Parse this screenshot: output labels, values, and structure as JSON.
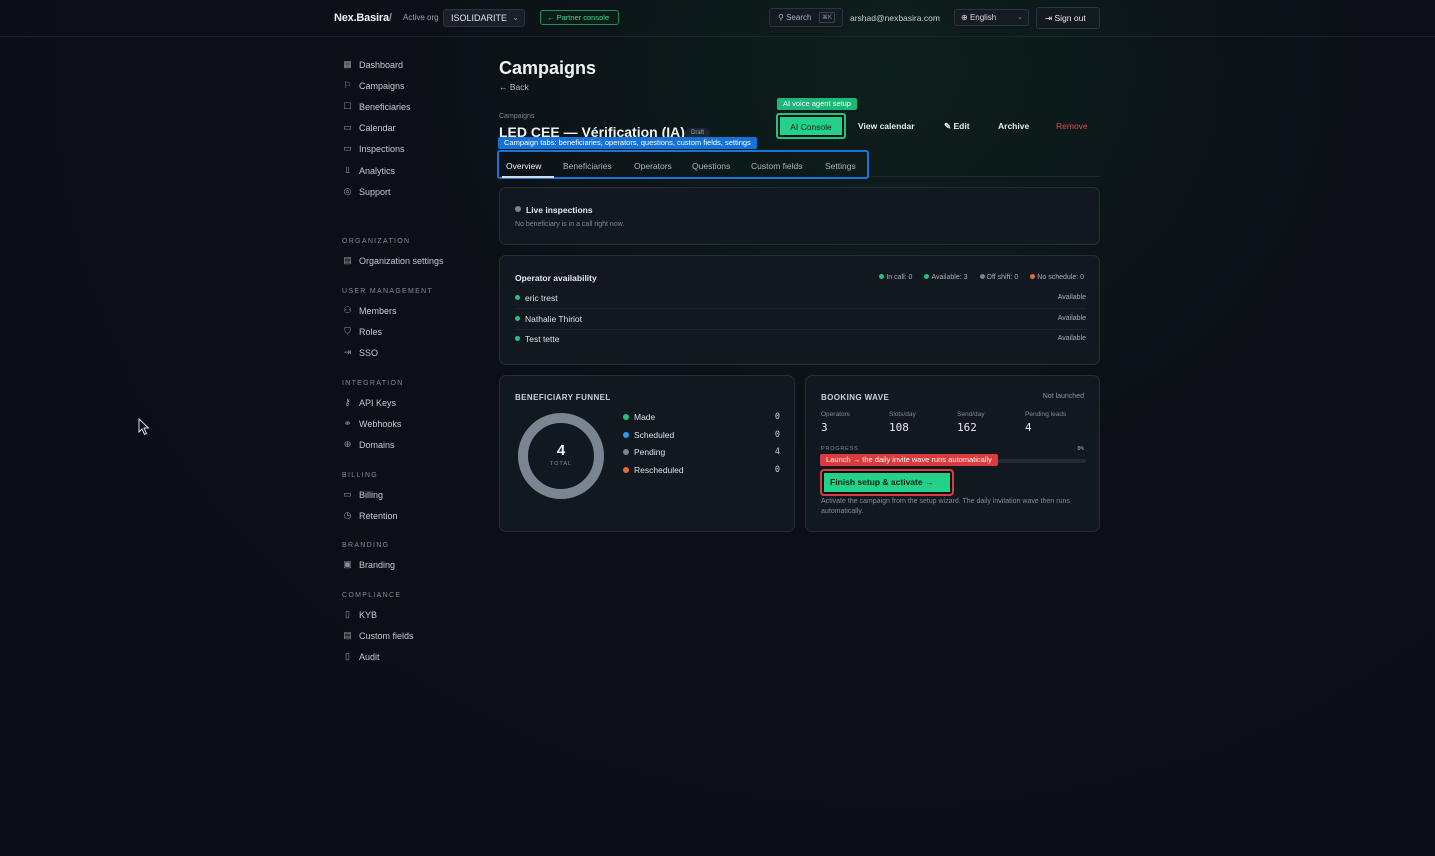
{
  "topbar": {
    "brand": "Nex.Basira",
    "brand_slash": "/",
    "active_org_label": "Active org",
    "active_org_value": "ISOLIDARITE",
    "partner_console": "← Partner console",
    "search_label": "Search",
    "search_shortcut": "⌘K",
    "user_email": "arshad@nexbasira.com",
    "language": "English",
    "sign_out": "Sign out"
  },
  "sidebar": {
    "main": [
      {
        "label": "Dashboard",
        "icon": "dashboard-icon",
        "glyph": "▦"
      },
      {
        "label": "Campaigns",
        "icon": "flag-icon",
        "glyph": "⚐"
      },
      {
        "label": "Beneficiaries",
        "icon": "id-card-icon",
        "glyph": "☐"
      },
      {
        "label": "Calendar",
        "icon": "calendar-icon",
        "glyph": "▭"
      },
      {
        "label": "Inspections",
        "icon": "video-icon",
        "glyph": "▭"
      },
      {
        "label": "Analytics",
        "icon": "chart-icon",
        "glyph": "⫫"
      },
      {
        "label": "Support",
        "icon": "lifebuoy-icon",
        "glyph": "◎"
      }
    ],
    "sections": [
      {
        "title": "ORGANIZATION",
        "items": [
          {
            "label": "Organization settings",
            "icon": "building-icon",
            "glyph": "▤"
          }
        ]
      },
      {
        "title": "USER MANAGEMENT",
        "items": [
          {
            "label": "Members",
            "icon": "users-icon",
            "glyph": "⚇"
          },
          {
            "label": "Roles",
            "icon": "shield-icon",
            "glyph": "⛉"
          },
          {
            "label": "SSO",
            "icon": "sso-icon",
            "glyph": "⇥"
          }
        ]
      },
      {
        "title": "INTEGRATION",
        "items": [
          {
            "label": "API Keys",
            "icon": "key-icon",
            "glyph": "⚷"
          },
          {
            "label": "Webhooks",
            "icon": "link-icon",
            "glyph": "⚭"
          },
          {
            "label": "Domains",
            "icon": "globe-icon",
            "glyph": "⊕"
          }
        ]
      },
      {
        "title": "BILLING",
        "items": [
          {
            "label": "Billing",
            "icon": "credit-card-icon",
            "glyph": "▭"
          },
          {
            "label": "Retention",
            "icon": "clock-icon",
            "glyph": "◷"
          }
        ]
      },
      {
        "title": "BRANDING",
        "items": [
          {
            "label": "Branding",
            "icon": "image-icon",
            "glyph": "▣"
          }
        ]
      },
      {
        "title": "COMPLIANCE",
        "items": [
          {
            "label": "KYB",
            "icon": "file-check-icon",
            "glyph": "▯"
          },
          {
            "label": "Custom fields",
            "icon": "form-icon",
            "glyph": "▤"
          },
          {
            "label": "Audit",
            "icon": "file-icon",
            "glyph": "▯"
          }
        ]
      }
    ]
  },
  "header": {
    "title": "Campaigns",
    "back": "← Back",
    "breadcrumb": "Campaigns",
    "campaign_title": "LED CEE — Vérification (IA)",
    "status_badge": "Draft"
  },
  "actions": {
    "ai_tooltip": "AI voice agent setup",
    "ai_console": "AI Console",
    "view_calendar": "View calendar",
    "edit": "✎ Edit",
    "archive": "Archive",
    "remove": "Remove"
  },
  "tabs": {
    "tooltip": "Campaign tabs: beneficiaries, operators, questions, custom fields, settings",
    "items": [
      "Overview",
      "Beneficiaries",
      "Operators",
      "Questions",
      "Custom fields",
      "Settings"
    ]
  },
  "live": {
    "title": "Live inspections",
    "empty": "No beneficiary is in a call right now."
  },
  "operators": {
    "title": "Operator availability",
    "stats": [
      "In call: 0",
      "Available: 3",
      "Off shift: 0",
      "No schedule: 0"
    ],
    "stat_colors": [
      "#22c37e",
      "#22c37e",
      "#7b8592",
      "#e36a3a"
    ],
    "rows": [
      {
        "name": "eric trest",
        "status": "Available"
      },
      {
        "name": "Nathalie Thiriot",
        "status": "Available"
      },
      {
        "name": "Test tette",
        "status": "Available"
      }
    ]
  },
  "funnel": {
    "title": "BENEFICIARY FUNNEL",
    "total": "4",
    "total_label": "TOTAL",
    "items": [
      {
        "label": "Made",
        "value": "0",
        "color": "#22c37e"
      },
      {
        "label": "Scheduled",
        "value": "0",
        "color": "#2f9be6"
      },
      {
        "label": "Pending",
        "value": "4",
        "color": "#7b8592"
      },
      {
        "label": "Rescheduled",
        "value": "0",
        "color": "#e36a3a"
      }
    ]
  },
  "booking": {
    "title": "BOOKING WAVE",
    "status": "Not launched",
    "stats": [
      {
        "key": "Operators",
        "value": "3"
      },
      {
        "key": "Slots/day",
        "value": "108"
      },
      {
        "key": "Send/day",
        "value": "162"
      },
      {
        "key": "Pending leads",
        "value": "4"
      }
    ],
    "progress_label": "PROGRESS",
    "progress_pct": "0%",
    "progress_value": 0,
    "launch_tooltip": "Launch → the daily invite wave runs automatically",
    "finish_button": "Finish setup & activate →",
    "note": "Activate the campaign from the setup wizard. The daily invitation wave then runs automatically."
  },
  "colors": {
    "accent": "#23d18b",
    "tab_highlight": "#1d74d6",
    "danger": "#d93c3c",
    "background": "#0c1016"
  }
}
